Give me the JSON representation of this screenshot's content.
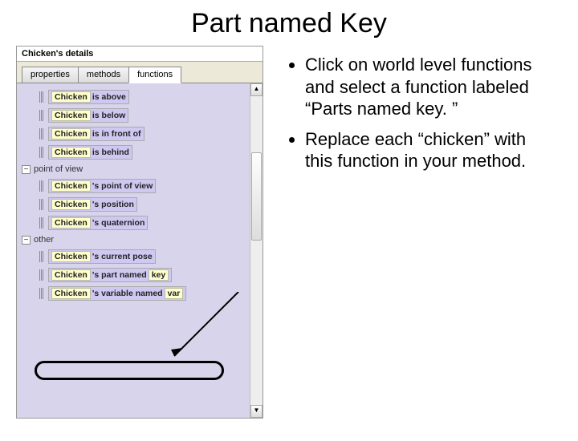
{
  "title": "Part named Key",
  "panel": {
    "header": "Chicken's details",
    "tabs": {
      "properties": "properties",
      "methods": "methods",
      "functions": "functions"
    },
    "spatial": [
      {
        "obj": "Chicken",
        "label": "is above"
      },
      {
        "obj": "Chicken",
        "label": "is below"
      },
      {
        "obj": "Chicken",
        "label": "is in front of"
      },
      {
        "obj": "Chicken",
        "label": "is behind"
      }
    ],
    "cat_pov": "point of view",
    "pov": [
      {
        "obj": "Chicken",
        "label": "'s point of view"
      },
      {
        "obj": "Chicken",
        "label": "'s position"
      },
      {
        "obj": "Chicken",
        "label": "'s quaternion"
      }
    ],
    "cat_other": "other",
    "other": [
      {
        "obj": "Chicken",
        "label": "'s current pose"
      },
      {
        "obj": "Chicken",
        "label": "'s part named",
        "arg": "key"
      },
      {
        "obj": "Chicken",
        "label": "'s variable named",
        "arg": "var"
      }
    ]
  },
  "bullets": [
    "Click on world level functions and select a function labeled “Parts named key. ”",
    "Replace each “chicken” with this function in your method."
  ]
}
